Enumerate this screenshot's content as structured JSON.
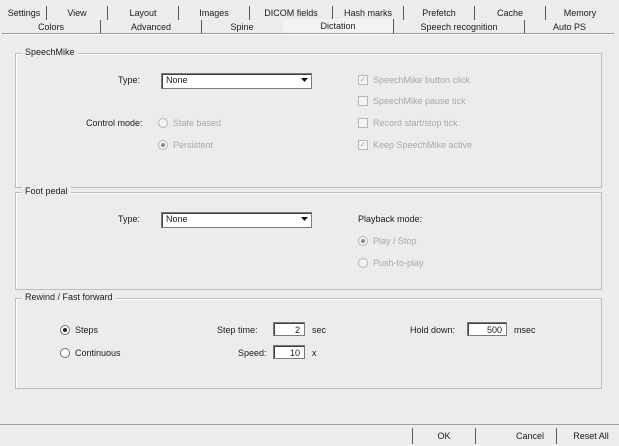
{
  "tabs": {
    "row1": [
      "Settings",
      "View",
      "Layout",
      "Images",
      "DICOM fields",
      "Hash marks",
      "Prefetch",
      "Cache",
      "Memory"
    ],
    "row2": [
      "Colors",
      "Advanced",
      "Spine",
      "Dictation",
      "Speech recognition",
      "Auto PS"
    ],
    "active": "Dictation"
  },
  "speechmike": {
    "title": "SpeechMike",
    "type_label": "Type:",
    "type_value": "None",
    "control_mode_label": "Control mode:",
    "state_based": "State based",
    "persistent": "Persistent",
    "selected_mode": "Persistent",
    "button_click": "SpeechMike button click",
    "pause_tick": "SpeechMike pause tick",
    "record_tick": "Record start/stop tick",
    "keep_active": "Keep SpeechMike active",
    "button_click_checked": true,
    "pause_tick_checked": false,
    "record_tick_checked": false,
    "keep_active_checked": true
  },
  "foot_pedal": {
    "title": "Foot pedal",
    "type_label": "Type:",
    "type_value": "None",
    "playback_label": "Playback mode:",
    "play_stop": "Play / Stop",
    "push_to_play": "Push-to-play",
    "selected_playback": "Play / Stop"
  },
  "rewind": {
    "title": "Rewind / Fast forward",
    "steps": "Steps",
    "continuous": "Continuous",
    "selected": "Steps",
    "step_time_label": "Step time:",
    "step_time_value": "2",
    "step_time_unit": "sec",
    "speed_label": "Speed:",
    "speed_value": "10",
    "speed_unit": "x",
    "hold_down_label": "Hold down:",
    "hold_down_value": "500",
    "hold_down_unit": "msec"
  },
  "buttons": {
    "ok": "OK",
    "cancel": "Cancel",
    "reset_all": "Reset All"
  }
}
